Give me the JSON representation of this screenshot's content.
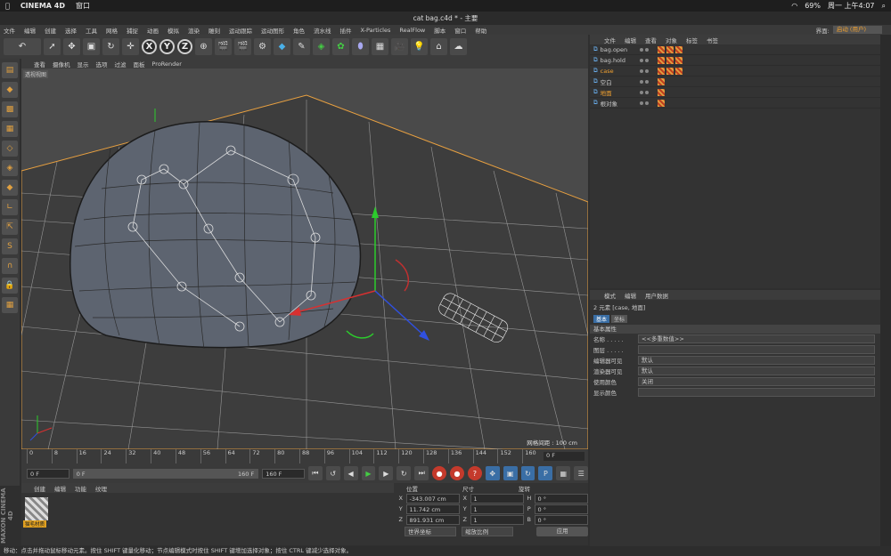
{
  "mac": {
    "app": "CINEMA 4D",
    "window_menu": "窗口",
    "battery": "69%",
    "clock": "周一 上午4:07"
  },
  "title": "cat bag.c4d * - 主要",
  "menubar": {
    "items": [
      "文件",
      "编辑",
      "创建",
      "选择",
      "工具",
      "网格",
      "捕捉",
      "动画",
      "模拟",
      "渲染",
      "雕刻",
      "运动跟踪",
      "运动图形",
      "角色",
      "流水线",
      "插件",
      "X-Particles",
      "RealFlow",
      "脚本",
      "窗口",
      "帮助"
    ],
    "layout_label": "界面:",
    "layout_value": "启动 (用户)"
  },
  "viewport": {
    "menu": [
      "查看",
      "摄像机",
      "显示",
      "选项",
      "过滤",
      "面板",
      "ProRender"
    ],
    "label": "透视视图",
    "grid_info": "网格间距 : 100 cm"
  },
  "timeline": {
    "ticks": [
      "0",
      "8",
      "16",
      "24",
      "32",
      "40",
      "48",
      "56",
      "64",
      "72",
      "80",
      "88",
      "96",
      "104",
      "112",
      "120",
      "128",
      "136",
      "144",
      "152",
      "160"
    ],
    "frame": "0 F"
  },
  "playback": {
    "start": "0 F",
    "range_start": "0 F",
    "range_end": "160 F",
    "end": "160 F"
  },
  "materials": {
    "menu": [
      "创建",
      "编辑",
      "功能",
      "纹理"
    ],
    "material_name": "猫毛材质",
    "brand": "MAXON CINEMA 4D"
  },
  "coords": {
    "headers": [
      "位置",
      "尺寸",
      "旋转"
    ],
    "rows": [
      {
        "a": "X",
        "pos": "-343.007 cm",
        "b": "X",
        "size": "1",
        "c": "H",
        "rot": "0 °"
      },
      {
        "a": "Y",
        "pos": "11.742 cm",
        "b": "Y",
        "size": "1",
        "c": "P",
        "rot": "0 °"
      },
      {
        "a": "Z",
        "pos": "891.931 cm",
        "b": "Z",
        "size": "1",
        "c": "B",
        "rot": "0 °"
      }
    ],
    "mode": "世界坐标",
    "scale_mode": "缩放比例",
    "apply": "应用"
  },
  "status": "移动：点击并拖动鼠标移动元素。按住 SHIFT 键量化移动；节点编辑模式时按住 SHIFT 键增加选择对象；按住 CTRL 键减少选择对象。",
  "objects": {
    "menu": [
      "文件",
      "编辑",
      "查看",
      "对象",
      "标签",
      "书签"
    ],
    "items": [
      {
        "name": "bag.open"
      },
      {
        "name": "bag.hold"
      },
      {
        "name": "case"
      },
      {
        "name": "空白"
      },
      {
        "name": "地面"
      },
      {
        "name": "根对象"
      }
    ]
  },
  "attributes": {
    "menu": [
      "模式",
      "编辑",
      "用户数据"
    ],
    "summary": "2 元素 [case, 地面]",
    "tabs": [
      "基本",
      "坐标"
    ],
    "section": "基本属性",
    "rows": [
      {
        "k": "名称 . . . . .",
        "v": "<<多重数值>>"
      },
      {
        "k": "图层 . . . . .",
        "v": ""
      },
      {
        "k": "编辑器可见",
        "v": "默认"
      },
      {
        "k": "渲染器可见",
        "v": "默认"
      },
      {
        "k": "使用颜色",
        "v": "关闭"
      },
      {
        "k": "显示颜色",
        "v": ""
      }
    ]
  }
}
